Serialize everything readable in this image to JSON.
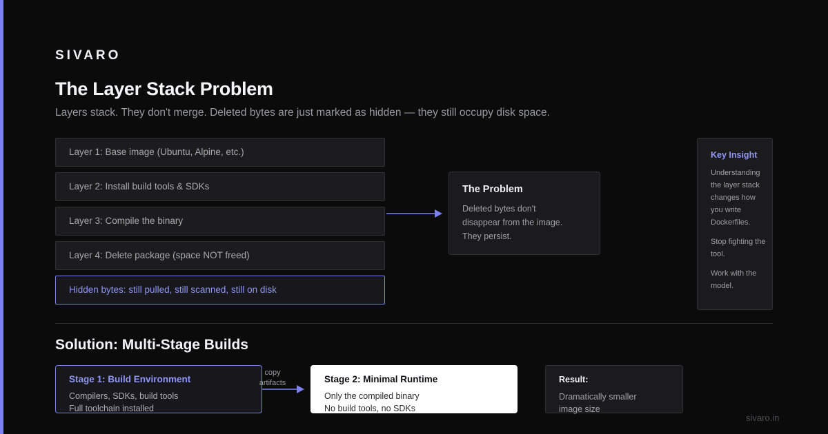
{
  "brand": "SIVARO",
  "title": "The Layer Stack Problem",
  "subtitle": "Layers stack. They don't merge. Deleted bytes are just marked as hidden — they still occupy disk space.",
  "layers": [
    "Layer 1: Base image (Ubuntu, Alpine, etc.)",
    "Layer 2: Install build tools & SDKs",
    "Layer 3: Compile the binary",
    "Layer 4: Delete package (space NOT freed)",
    "Hidden bytes: still pulled, still scanned, still on disk"
  ],
  "problem": {
    "title": "The Problem",
    "body": "Deleted bytes don't disappear from the image. They persist."
  },
  "insight": {
    "title": "Key Insight",
    "paragraphs": [
      "Understanding the layer stack changes how you write Dockerfiles.",
      "Stop fighting the tool.",
      "Work with the model."
    ]
  },
  "solution": {
    "title": "Solution: Multi-Stage Builds",
    "stage1": {
      "title": "Stage 1: Build Environment",
      "lines": [
        "Compilers, SDKs, build tools",
        "Full toolchain installed"
      ]
    },
    "arrow_label": [
      "copy",
      "artifacts"
    ],
    "stage2": {
      "title": "Stage 2: Minimal Runtime",
      "lines": [
        "Only the compiled binary",
        "No build tools, no SDKs"
      ]
    },
    "result": {
      "title": "Result:",
      "lines": [
        "Dramatically smaller",
        "image size"
      ]
    }
  },
  "footer": "sivaro.in",
  "colors": {
    "accent": "#7b82f0",
    "background": "#0b0b0c",
    "card": "#1c1c1f"
  }
}
